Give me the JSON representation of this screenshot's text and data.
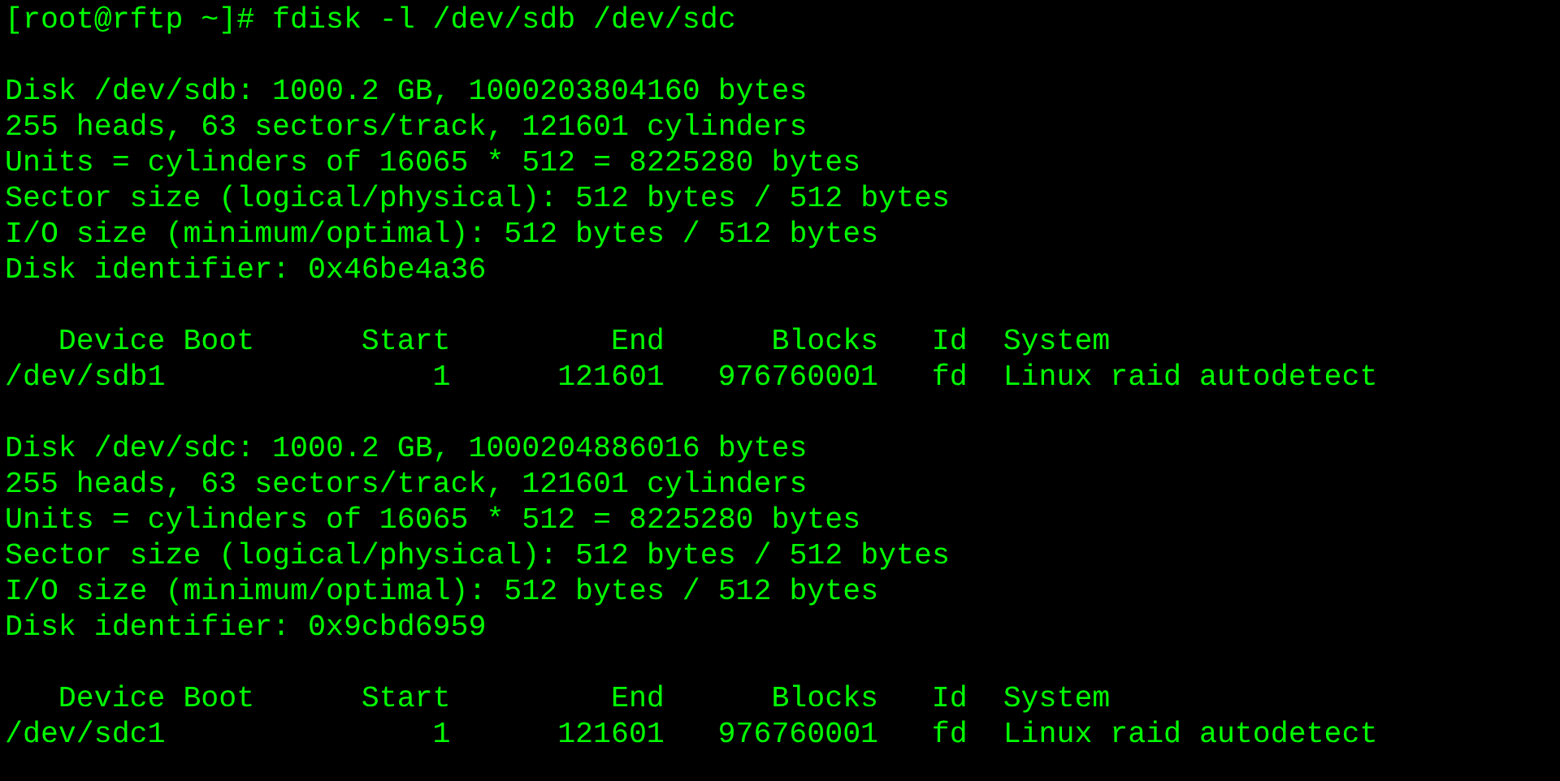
{
  "command_line": "[root@rftp ~]# fdisk -l /dev/sdb /dev/sdc",
  "disks": [
    {
      "info": [
        "Disk /dev/sdb: 1000.2 GB, 1000203804160 bytes",
        "255 heads, 63 sectors/track, 121601 cylinders",
        "Units = cylinders of 16065 * 512 = 8225280 bytes",
        "Sector size (logical/physical): 512 bytes / 512 bytes",
        "I/O size (minimum/optimal): 512 bytes / 512 bytes",
        "Disk identifier: 0x46be4a36"
      ],
      "columns": [
        "Device Boot",
        "Start",
        "End",
        "Blocks",
        "Id",
        "System"
      ],
      "rows": [
        [
          "/dev/sdb1",
          "1",
          "121601",
          "976760001",
          "fd",
          "Linux raid autodetect"
        ]
      ]
    },
    {
      "info": [
        "Disk /dev/sdc: 1000.2 GB, 1000204886016 bytes",
        "255 heads, 63 sectors/track, 121601 cylinders",
        "Units = cylinders of 16065 * 512 = 8225280 bytes",
        "Sector size (logical/physical): 512 bytes / 512 bytes",
        "I/O size (minimum/optimal): 512 bytes / 512 bytes",
        "Disk identifier: 0x9cbd6959"
      ],
      "columns": [
        "Device Boot",
        "Start",
        "End",
        "Blocks",
        "Id",
        "System"
      ],
      "rows": [
        [
          "/dev/sdc1",
          "1",
          "121601",
          "976760001",
          "fd",
          "Linux raid autodetect"
        ]
      ]
    }
  ]
}
